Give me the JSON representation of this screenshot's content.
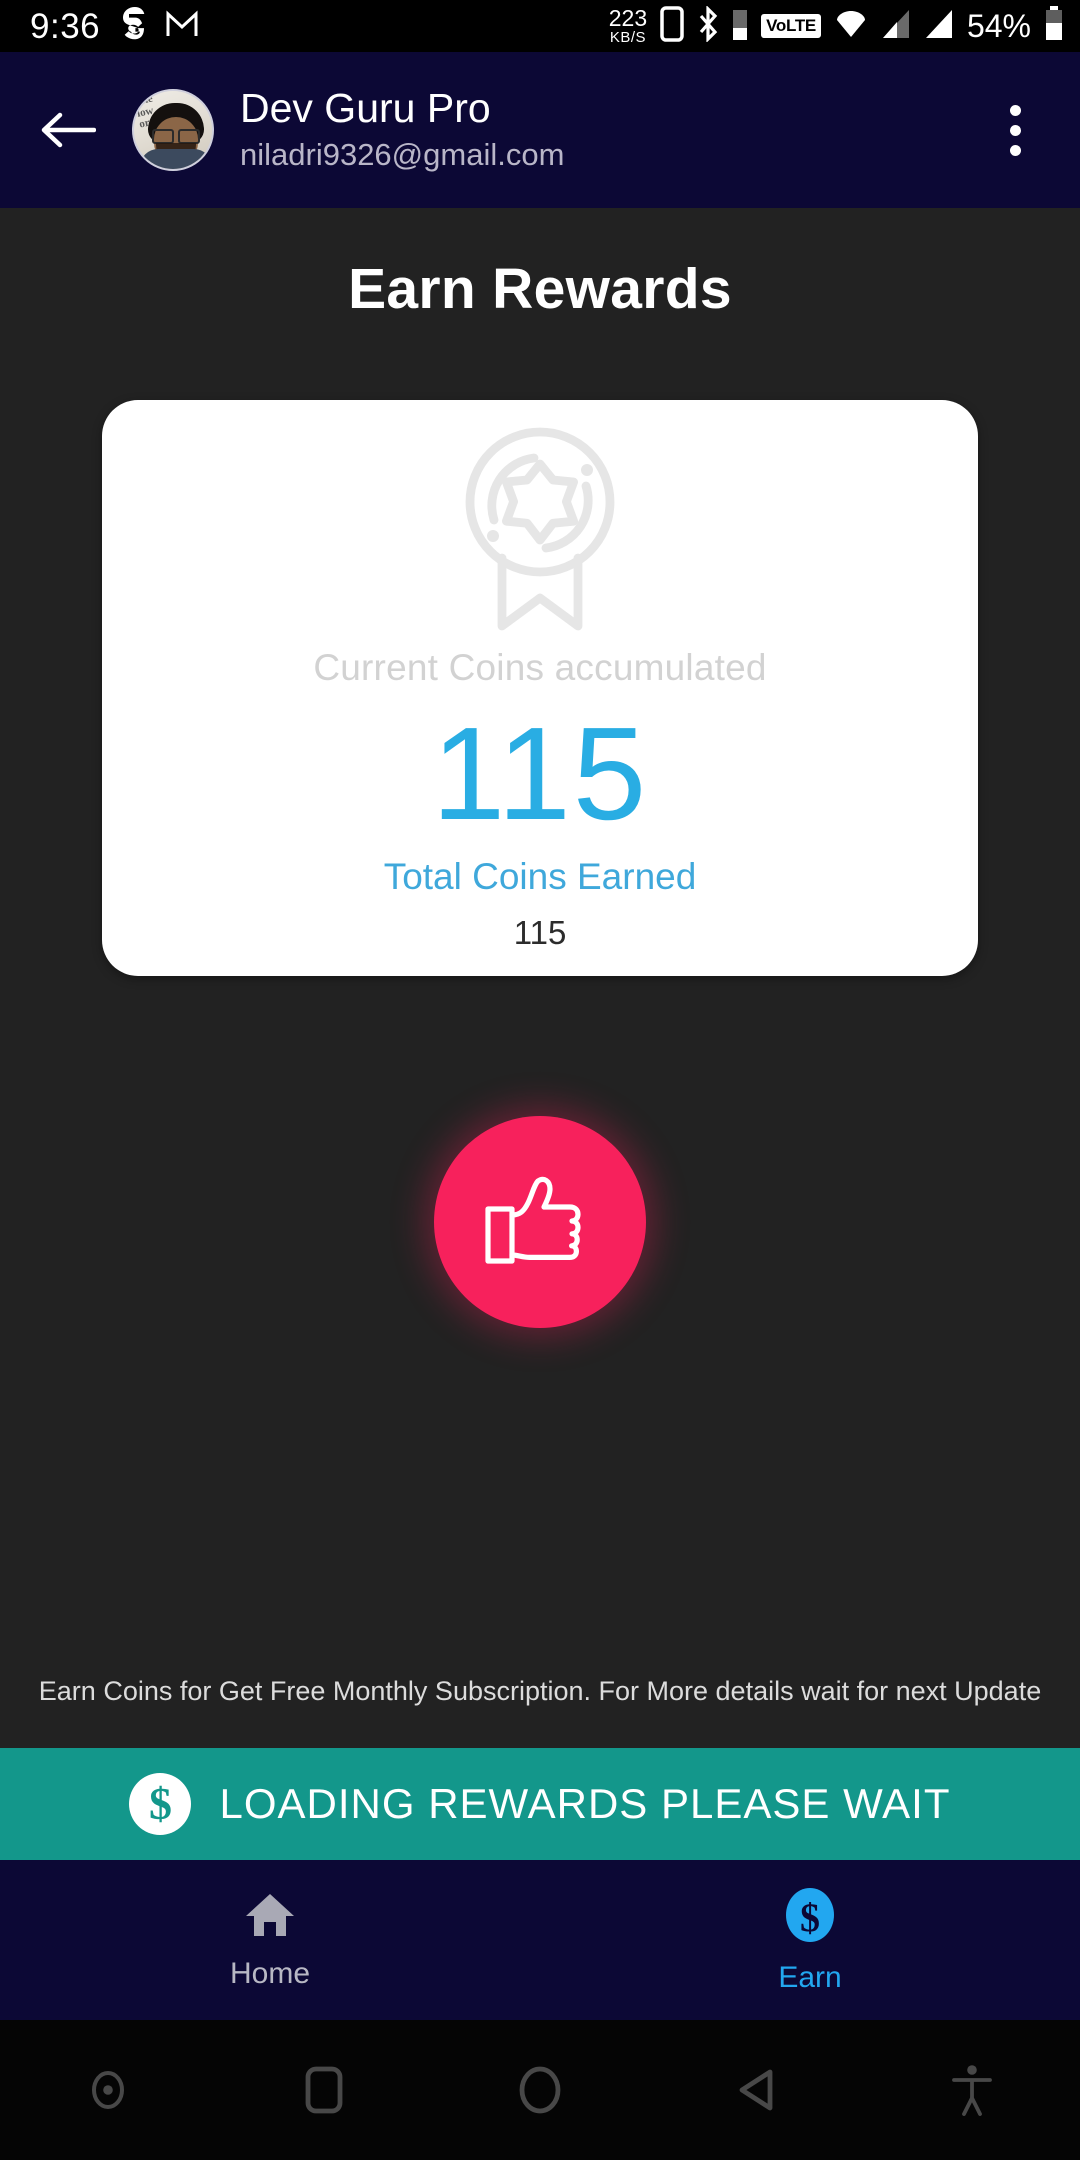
{
  "status_bar": {
    "clock": "9:36",
    "left_icons": [
      "swiggy-icon",
      "gmail-icon"
    ],
    "network_speed_value": "223",
    "network_speed_unit": "KB/S",
    "right_icons": [
      "sim-card-icon",
      "bluetooth-icon",
      "bluetooth-battery-icon",
      "volte-icon",
      "wifi-icon",
      "signal-bar-icon-1",
      "signal-bar-icon-2"
    ],
    "volte_label": "VoLTE",
    "battery_percent": "54%"
  },
  "app_bar": {
    "back_icon": "arrow-left-icon",
    "avatar_alt": "user-avatar",
    "title": "Dev Guru Pro",
    "subtitle": "niladri9326@gmail.com",
    "overflow_icon": "more-vertical-icon"
  },
  "main": {
    "page_title": "Earn Rewards",
    "card": {
      "medal_icon": "medal-badge-icon",
      "label": "Current Coins accumulated",
      "coin_count": "115",
      "total_label": "Total Coins Earned",
      "total_value": "115"
    },
    "fab": {
      "icon": "thumbs-up-icon",
      "color": "#f7215c"
    },
    "footer_note": "Earn Coins for Get Free Monthly Subscription. For More details wait for next Update"
  },
  "loading_banner": {
    "icon": "dollar-coin-icon",
    "icon_glyph": "$",
    "text": "LOADING REWARDS PLEASE WAIT",
    "color": "#13978b"
  },
  "bottom_nav": {
    "items": [
      {
        "label": "Home",
        "icon": "home-icon",
        "active": false,
        "color": "#b8b8c4"
      },
      {
        "label": "Earn",
        "icon": "dollar-coin-icon",
        "active": true,
        "color": "#22a7f0"
      }
    ]
  },
  "android_nav": {
    "icons": [
      "screen-record-icon",
      "recents-square-icon",
      "home-circle-icon",
      "back-triangle-icon",
      "accessibility-icon"
    ]
  },
  "colors": {
    "app_bar": "#0c0835",
    "background": "#222222",
    "accent_blue": "#29ade3",
    "accent_pink": "#f7215c",
    "accent_teal": "#13978b"
  }
}
